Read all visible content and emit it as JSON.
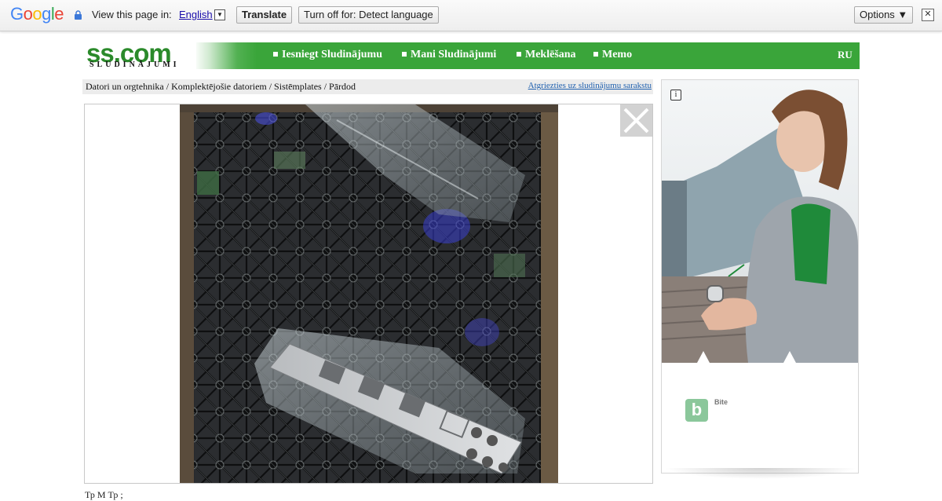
{
  "translate_bar": {
    "logo": "Google",
    "prompt": "View this page in:",
    "language": "English",
    "translate_button": "Translate",
    "turn_off_button": "Turn off for: Detect language",
    "options_button": "Options ▼",
    "close_glyph": "✕",
    "lang_dropdown_glyph": "▼"
  },
  "site": {
    "logo_main": "ss.com",
    "logo_sub": "SLUDINĀJUMI",
    "nav": [
      {
        "label": "Iesniegt Sludinājumu"
      },
      {
        "label": "Mani Sludinājumi"
      },
      {
        "label": "Meklēšana"
      },
      {
        "label": "Memo"
      }
    ],
    "lang_switch": "RU"
  },
  "breadcrumb": {
    "path": "Datori un orgtehnika / Komplektējošie datoriem / Sistēmplates / Pārdod",
    "back_link": "Atgriezties uz sludinājumu sarakstu"
  },
  "ad": {
    "info_glyph": "i",
    "brand_glyph": "b",
    "brand_name": "Bite"
  },
  "bottom_text": "Тр             М             Тр                                        ;"
}
